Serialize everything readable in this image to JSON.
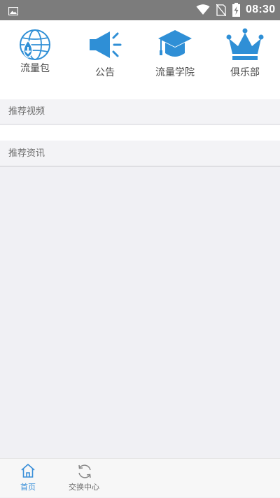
{
  "status_bar": {
    "time": "08:30",
    "icons": [
      "image-icon",
      "wifi-icon",
      "no-sim-icon",
      "battery-charging-icon"
    ]
  },
  "top_menu": {
    "items": [
      {
        "label": "流量包",
        "icon": "globe-download-icon"
      },
      {
        "label": "公告",
        "icon": "megaphone-icon"
      },
      {
        "label": "流量学院",
        "icon": "graduation-cap-icon"
      },
      {
        "label": "俱乐部",
        "icon": "crown-icon"
      }
    ]
  },
  "sections": {
    "videos": {
      "title": "推荐视频"
    },
    "news": {
      "title": "推荐资讯"
    }
  },
  "bottom_nav": {
    "items": [
      {
        "label": "首页",
        "icon": "home-icon",
        "active": true
      },
      {
        "label": "交换中心",
        "icon": "refresh-icon",
        "active": false
      }
    ]
  },
  "colors": {
    "accent": "#2f8fd6",
    "status_bar": "#7c7c7c",
    "page_background": "#f0f0f4"
  }
}
